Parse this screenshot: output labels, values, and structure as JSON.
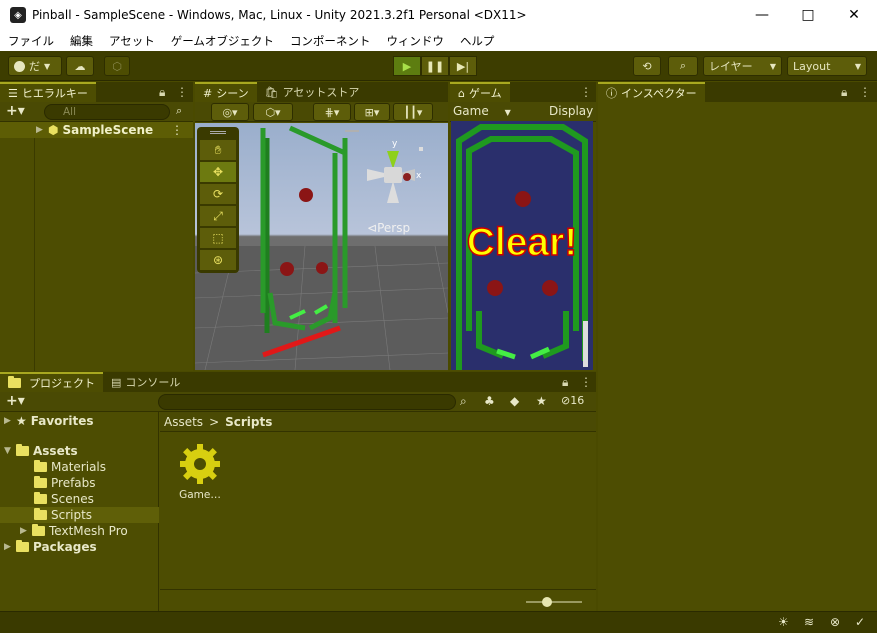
{
  "window": {
    "title": "Pinball - SampleScene - Windows, Mac, Linux - Unity 2021.3.2f1 Personal <DX11>",
    "controls": [
      "—",
      "□",
      "✕"
    ]
  },
  "menu": [
    "ファイル",
    "編集",
    "アセット",
    "ゲームオブジェクト",
    "コンポーネント",
    "ウィンドウ",
    "ヘルプ"
  ],
  "toolbar": {
    "account_label": "だ",
    "layers_label": "レイヤー",
    "layout_label": "Layout"
  },
  "hierarchy": {
    "tab": "ヒエラルキー",
    "search_placeholder": "All",
    "scene_name": "SampleScene"
  },
  "scene": {
    "tab_scene": "シーン",
    "tab_store": "アセットストア",
    "persp_label": "Persp",
    "gizmo_axes": [
      "y",
      "x"
    ]
  },
  "game": {
    "tab": "ゲーム",
    "mode": "Game",
    "display": "Display",
    "overlay_text": "Clear!"
  },
  "inspector": {
    "tab": "インスペクター"
  },
  "project": {
    "tab_project": "プロジェクト",
    "tab_console": "コンソール",
    "hidden_count": "16",
    "favorites": "Favorites",
    "assets": "Assets",
    "folders": [
      "Materials",
      "Prefabs",
      "Scenes",
      "Scripts",
      "TextMesh Pro"
    ],
    "packages": "Packages",
    "breadcrumb_root": "Assets",
    "breadcrumb_current": "Scripts",
    "file_label": "Game…"
  },
  "colors": {
    "panel": "#4d4d02",
    "accent": "#e9e060",
    "scene_pin": "#1f8c1f",
    "ball": "#8b1515",
    "clear_text": "#ffff00",
    "clear_outline": "#cc0000"
  }
}
